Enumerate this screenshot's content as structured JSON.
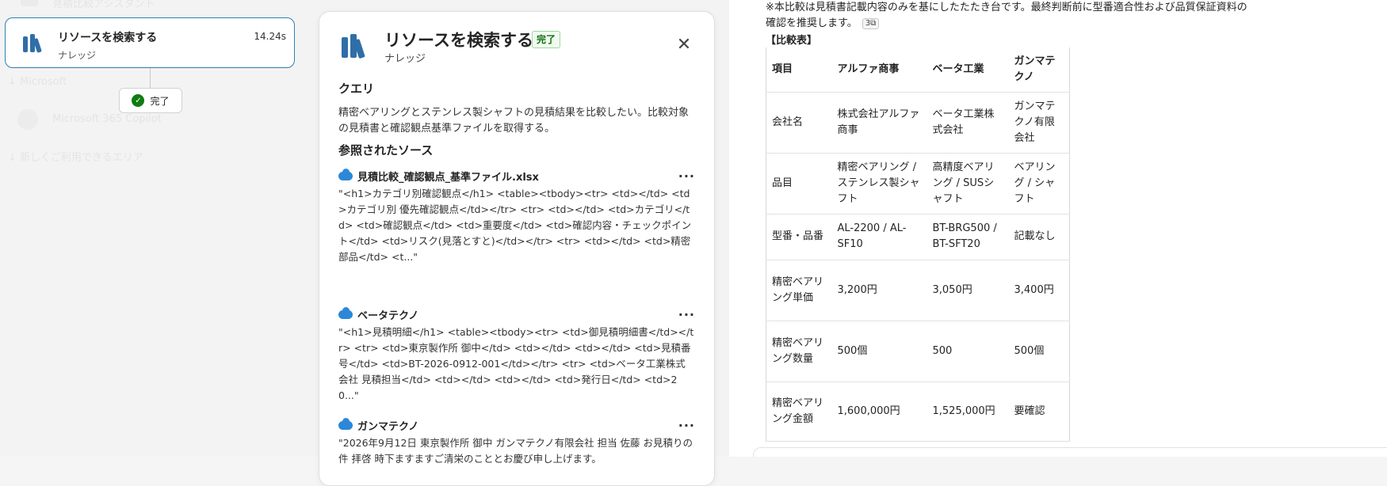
{
  "canvas": {
    "ghost_top": "見積比較アシスタント",
    "ghost_mid": "↓ Microsoft",
    "ghost_item": "Microsoft 365 Copilot",
    "ghost_bottom": "↓ 新しくご利用できるエリア",
    "step_card": {
      "title": "リソースを検索する",
      "subtitle": "ナレッジ",
      "duration": "14.24s",
      "icon": "books-icon"
    },
    "status": {
      "label": "完了",
      "icon": "check-circle-icon"
    }
  },
  "panel": {
    "title": "リソースを検索する",
    "badge": "完了",
    "subtitle": "ナレッジ",
    "close_icon": "close-icon",
    "query_heading": "クエリ",
    "query_text": "精密ベアリングとステンレス製シャフトの見積結果を比較したい。比較対象の見積書と確認観点基準ファイルを取得する。",
    "sources_heading": "参照されたソース",
    "sources": [
      {
        "name": "見積比較_確認観点_基準ファイル.xlsx",
        "snippet": "\"<h1>カテゴリ別確認観点</h1> <table><tbody><tr> <td></td> <td>カテゴリ別 優先確認観点</td></tr> <tr> <td></td> <td>カテゴリ</td> <td>確認観点</td> <td>重要度</td> <td>確認内容・チェックポイント</td> <td>リスク(見落とすと)</td></tr> <tr> <td></td> <td>精密部品</td> <t...\""
      },
      {
        "name": "ベータテクノ",
        "snippet": "\"<h1>見積明細</h1> <table><tbody><tr> <td>御見積明細書</td></tr> <tr> <td>東京製作所 御中</td> <td></td> <td></td> <td>見積番号</td> <td>BT-2026-0912-001</td></tr> <tr> <td>ベータ工業株式会社 見積担当</td> <td></td> <td></td> <td>発行日</td> <td>20...\""
      },
      {
        "name": "ガンマテクノ",
        "snippet": "\"2026年9月12日 東京製作所 御中 ガンマテクノ有限会社 担当 佐藤 お見積りの件 拝啓 時下ますますご清栄のこととお慶び申し上げます。"
      }
    ]
  },
  "chat": {
    "note": "※本比較は見積書記載内容のみを基にしたたたき台です。最終判断前に型番適合性および品質保証資料の確認を推奨します。",
    "citation": "3",
    "table_heading": "【比較表】",
    "table": {
      "headers": [
        "項目",
        "アルファ商事",
        "ベータ工業",
        "ガンマテクノ"
      ],
      "rows": [
        [
          "会社名",
          "株式会社アルファ商事",
          "ベータ工業株式会社",
          "ガンマテクノ有限会社"
        ],
        [
          "品目",
          "精密ベアリング / ステンレス製シャフト",
          "高精度ベアリング / SUSシャフト",
          "ベアリング / シャフト"
        ],
        [
          "型番・品番",
          "AL-2200 / AL-SF10",
          "BT-BRG500 / BT-SFT20",
          "記載なし"
        ],
        [
          "精密ベアリング単価",
          "3,200円",
          "3,050円",
          "3,400円"
        ],
        [
          "精密ベアリング数量",
          "500個",
          "500",
          "500個"
        ],
        [
          "精密ベアリング金額",
          "1,600,000円",
          "1,525,000円",
          "要確認"
        ]
      ]
    }
  }
}
